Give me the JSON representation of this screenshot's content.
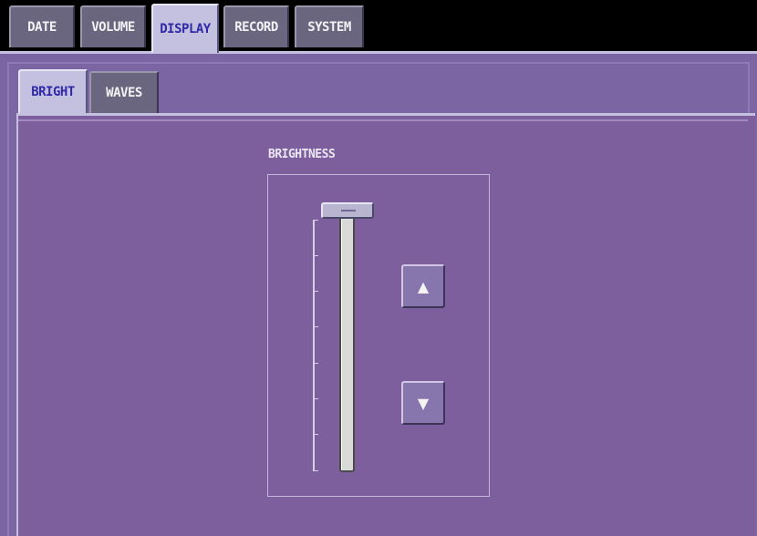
{
  "top_tabs": [
    {
      "label": "DATE",
      "active": false
    },
    {
      "label": "VOLUME",
      "active": false
    },
    {
      "label": "DISPLAY",
      "active": true
    },
    {
      "label": "RECORD",
      "active": false
    },
    {
      "label": "SYSTEM",
      "active": false
    }
  ],
  "sub_tabs": [
    {
      "label": "BRIGHT",
      "active": true
    },
    {
      "label": "WAVES",
      "active": false
    }
  ],
  "brightness": {
    "title": "BRIGHTNESS",
    "level": 1.0,
    "up_icon": "▲",
    "down_icon": "▼"
  },
  "colors": {
    "panel": "#7e5f9e",
    "active_tab": "#c3c1df",
    "inactive_tab": "#6b6680",
    "active_tab_text": "#2f2aa8"
  }
}
